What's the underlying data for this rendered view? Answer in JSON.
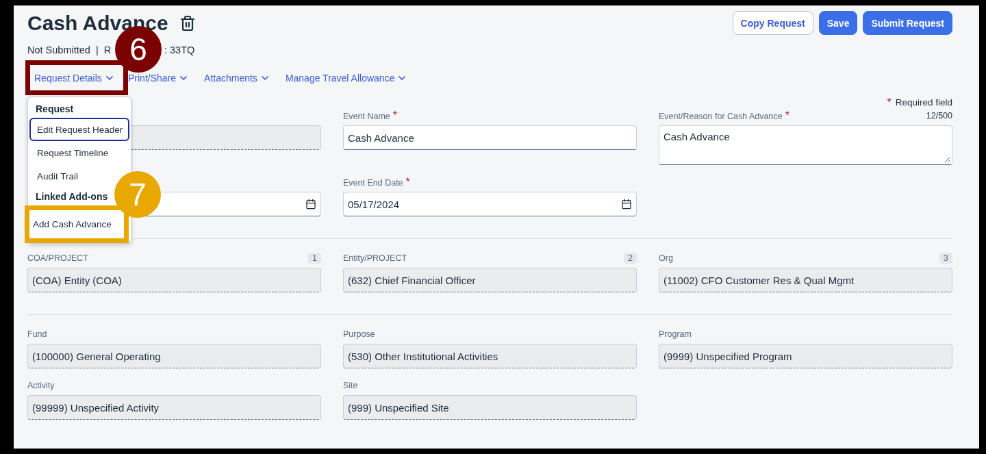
{
  "title": "Cash Advance",
  "status": {
    "before": "Not Submitted  |  R",
    "after": ": 33TQ"
  },
  "actions": [
    {
      "label": "Copy Request",
      "kind": "secondary"
    },
    {
      "label": "Save",
      "kind": "primary"
    },
    {
      "label": "Submit Request",
      "kind": "primary"
    }
  ],
  "menu_tabs": [
    {
      "label": "Request Details",
      "callout": {
        "number": "6",
        "color": "#7b0000"
      },
      "dropdown": {
        "items": [
          {
            "kind": "header",
            "label": "Request"
          },
          {
            "kind": "item",
            "label": "Edit Request Header",
            "focused": true
          },
          {
            "kind": "item",
            "label": "Request Timeline",
            "focused": false
          },
          {
            "kind": "item",
            "label": "Audit Trail",
            "focused": false
          },
          {
            "kind": "header",
            "label": "Linked Add-ons"
          },
          {
            "kind": "item",
            "label": "Add Cash Advance",
            "focused": false,
            "callout": {
              "number": "7",
              "color": "#e8a800"
            }
          }
        ]
      }
    },
    {
      "label": "Print/Share"
    },
    {
      "label": "Attachments"
    },
    {
      "label": "Manage Travel Allowance"
    }
  ],
  "required_note": {
    "marker": "*",
    "text": "Required field"
  },
  "sections": [
    {
      "rows": [
        [
          {
            "kind": "readonly"
          },
          {
            "kind": "text",
            "label": "Event Name",
            "marker": "*",
            "value": "Cash Advance"
          },
          {
            "kind": "textarea",
            "label": "Event/Reason for Cash Advance",
            "marker": "*",
            "counter": "12/500",
            "value": "Cash Advance"
          }
        ],
        [
          {
            "kind": "date"
          },
          {
            "kind": "date",
            "label": "Event End Date",
            "marker": "*",
            "value": "05/17/2024"
          },
          {
            "kind": "empty"
          }
        ]
      ]
    },
    {
      "rows": [
        [
          {
            "kind": "readonly",
            "label": "COA/PROJECT",
            "badge": "1",
            "value": "(COA) Entity (COA)"
          },
          {
            "kind": "readonly",
            "label": "Entity/PROJECT",
            "badge": "2",
            "value": "(632) Chief Financial Officer"
          },
          {
            "kind": "readonly",
            "label": "Org",
            "badge": "3",
            "value": "(11002) CFO Customer Res & Qual Mgmt"
          }
        ]
      ]
    },
    {
      "rows": [
        [
          {
            "kind": "readonly",
            "label": "Fund",
            "value": "(100000) General Operating"
          },
          {
            "kind": "readonly",
            "label": "Purpose",
            "value": "(530) Other Institutional Activities"
          },
          {
            "kind": "readonly",
            "label": "Program",
            "value": "(9999) Unspecified Program"
          }
        ],
        [
          {
            "kind": "readonly",
            "label": "Activity",
            "value": "(99999) Unspecified Activity"
          },
          {
            "kind": "readonly",
            "label": "Site",
            "value": "(999) Unspecified Site"
          },
          {
            "kind": "empty"
          }
        ]
      ]
    }
  ]
}
